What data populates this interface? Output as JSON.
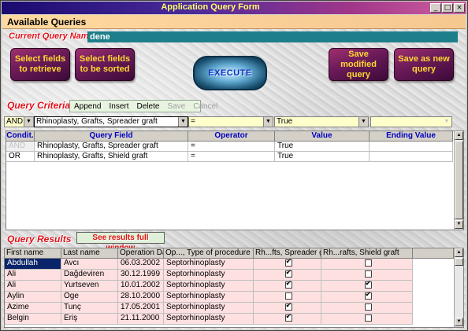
{
  "window": {
    "title": "Application Query Form",
    "controls": [
      "_",
      "□",
      "×"
    ]
  },
  "header": {
    "title": "Available Queries"
  },
  "current_query": {
    "label": "Current Query Name",
    "value": "dene"
  },
  "buttons": {
    "select_retrieve": "Select fields to retrieve",
    "select_sorted": "Select fields to be sorted",
    "execute": "EXECUTE",
    "save_modified": "Save modified query",
    "save_new": "Save as new query"
  },
  "criteria": {
    "label": "Query Criteria",
    "nav": {
      "append": "Append",
      "insert": "Insert",
      "delete": "Delete",
      "save": "Save",
      "cancel": "Cancel"
    },
    "editor": {
      "condition": "AND",
      "field": "Rhinoplasty, Grafts, Spreader graft",
      "operator": "=",
      "value": "True",
      "ending": ""
    },
    "columns": [
      "Condit.",
      "Query Field",
      "Operator",
      "Value",
      "Ending Value"
    ],
    "rows": [
      {
        "cond": "AND",
        "field": "Rhinoplasty, Grafts, Spreader graft",
        "op": "=",
        "value": "True",
        "ending": ""
      },
      {
        "cond": "OR",
        "field": "Rhinoplasty, Grafts, Shield graft",
        "op": "=",
        "value": "True",
        "ending": ""
      }
    ]
  },
  "results": {
    "label": "Query Results",
    "full_window_button": "See results full window",
    "columns": [
      "First name",
      "Last name",
      "Operation Date",
      "Op..., Type of procedure",
      "Rh...fts, Spreader graft",
      "Rh...rafts, Shield graft"
    ],
    "rows": [
      {
        "first": "Abdullah",
        "last": "Avcı",
        "date": "06.03.2002",
        "type": "Septorhinoplasty",
        "spreader": true,
        "shield": false
      },
      {
        "first": "Ali",
        "last": "Dağdeviren",
        "date": "30.12.1999",
        "type": "Septorhinoplasty",
        "spreader": true,
        "shield": false
      },
      {
        "first": "Ali",
        "last": "Yurtseven",
        "date": "10.01.2002",
        "type": "Septorhinoplasty",
        "spreader": true,
        "shield": true
      },
      {
        "first": "Aylin",
        "last": "Öge",
        "date": "28.10.2000",
        "type": "Septorhinoplasty",
        "spreader": false,
        "shield": true
      },
      {
        "first": "Azime",
        "last": "Tunç",
        "date": "17.05.2001",
        "type": "Septorhinoplasty",
        "spreader": true,
        "shield": false
      },
      {
        "first": "Belgin",
        "last": "Eriş",
        "date": "21.11.2000",
        "type": "Septorhinoplasty",
        "spreader": true,
        "shield": false
      }
    ]
  },
  "colors": {
    "accent_red": "#e0101a",
    "button_purple": "#6a1a58",
    "button_text_yellow": "#ffd830",
    "results_row_pink": "#ffe0e0",
    "query_name_teal": "#1e7e8a"
  }
}
